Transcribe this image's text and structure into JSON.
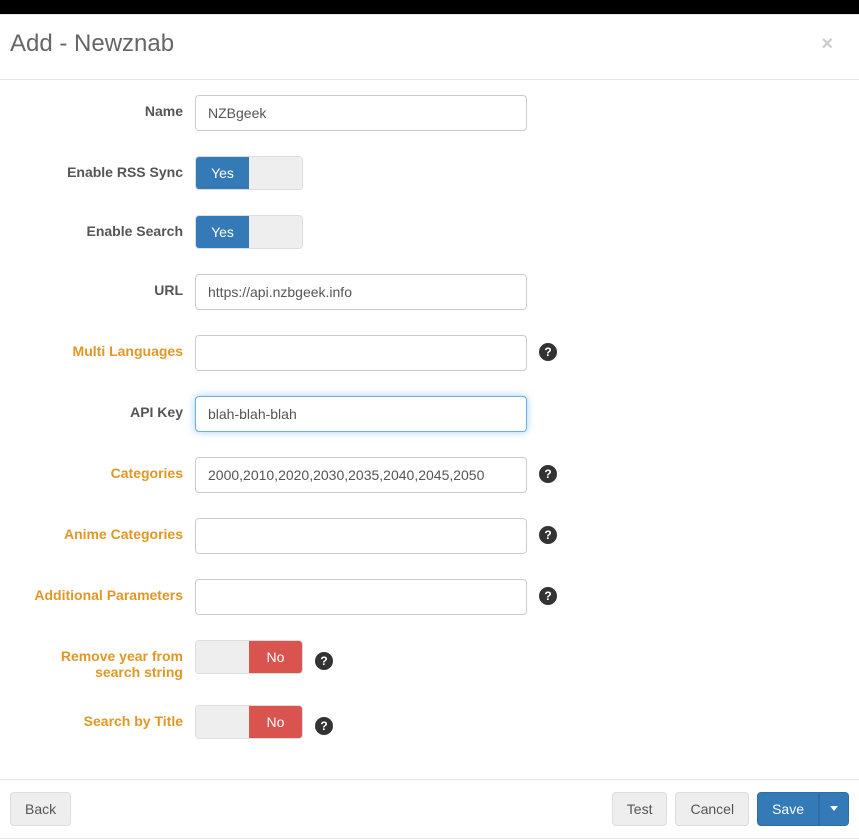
{
  "modal": {
    "title": "Add - Newznab",
    "close": "×"
  },
  "form": {
    "name": {
      "label": "Name",
      "value": "NZBgeek"
    },
    "rss": {
      "label": "Enable RSS Sync",
      "value": "Yes"
    },
    "search": {
      "label": "Enable Search",
      "value": "Yes"
    },
    "url": {
      "label": "URL",
      "value": "https://api.nzbgeek.info"
    },
    "multiLang": {
      "label": "Multi Languages",
      "value": ""
    },
    "apiKey": {
      "label": "API Key",
      "value": "blah-blah-blah"
    },
    "categories": {
      "label": "Categories",
      "value": "2000,2010,2020,2030,2035,2040,2045,2050"
    },
    "animeCategories": {
      "label": "Anime Categories",
      "value": ""
    },
    "addlParams": {
      "label": "Additional Parameters",
      "value": ""
    },
    "removeYear": {
      "label": "Remove year from search string",
      "value": "No"
    },
    "searchByTitle": {
      "label": "Search by Title",
      "value": "No"
    }
  },
  "toggle": {
    "yes": "Yes",
    "no": "No"
  },
  "help": "?",
  "footer": {
    "back": "Back",
    "test": "Test",
    "cancel": "Cancel",
    "save": "Save"
  }
}
